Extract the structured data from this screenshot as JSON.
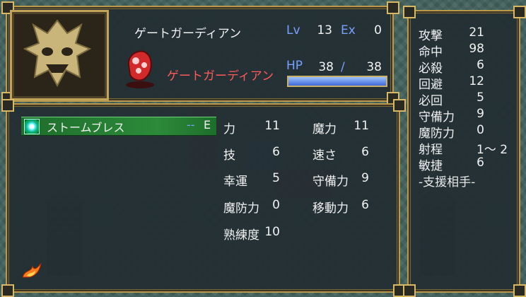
{
  "unit": {
    "class_name": "ゲートガーディアン",
    "name": "ゲートガーディアン",
    "lv_label": "Lv",
    "lv": "13",
    "ex_label": "Ex",
    "ex": "0",
    "hp_label": "HP",
    "hp_current": "38",
    "hp_sep": "/",
    "hp_max": "38",
    "hp_fraction": 1.0
  },
  "item": {
    "name": "ストームブレス",
    "uses": "--",
    "equipped_mark": "E",
    "icon": "storm-breath-icon"
  },
  "stats_center": [
    {
      "label": "力",
      "value": "11"
    },
    {
      "label": "魔力",
      "value": "11"
    },
    {
      "label": "技",
      "value": "6"
    },
    {
      "label": "速さ",
      "value": "6"
    },
    {
      "label": "幸運",
      "value": "5"
    },
    {
      "label": "守備力",
      "value": "9"
    },
    {
      "label": "魔防力",
      "value": "0"
    },
    {
      "label": "移動力",
      "value": "6"
    },
    {
      "label": "熟練度",
      "value": "10"
    }
  ],
  "stats_right": [
    {
      "label": "攻撃",
      "value": "21"
    },
    {
      "label": "命中",
      "value": "98"
    },
    {
      "label": "必殺",
      "value": "6"
    },
    {
      "label": "回避",
      "value": "12"
    },
    {
      "label": "必回",
      "value": "5"
    },
    {
      "label": "守備力",
      "value": "9"
    },
    {
      "label": "魔防力",
      "value": "0"
    },
    {
      "label": "射程",
      "value": "1～ 2"
    },
    {
      "label": "敏捷",
      "value": "6"
    }
  ],
  "support_label": "-支援相手-",
  "colors": {
    "frame": "#b99a4c",
    "hp_fill": "#4f78e6",
    "item_row": "#2c8a3a",
    "name_red": "#ff5a5a"
  }
}
